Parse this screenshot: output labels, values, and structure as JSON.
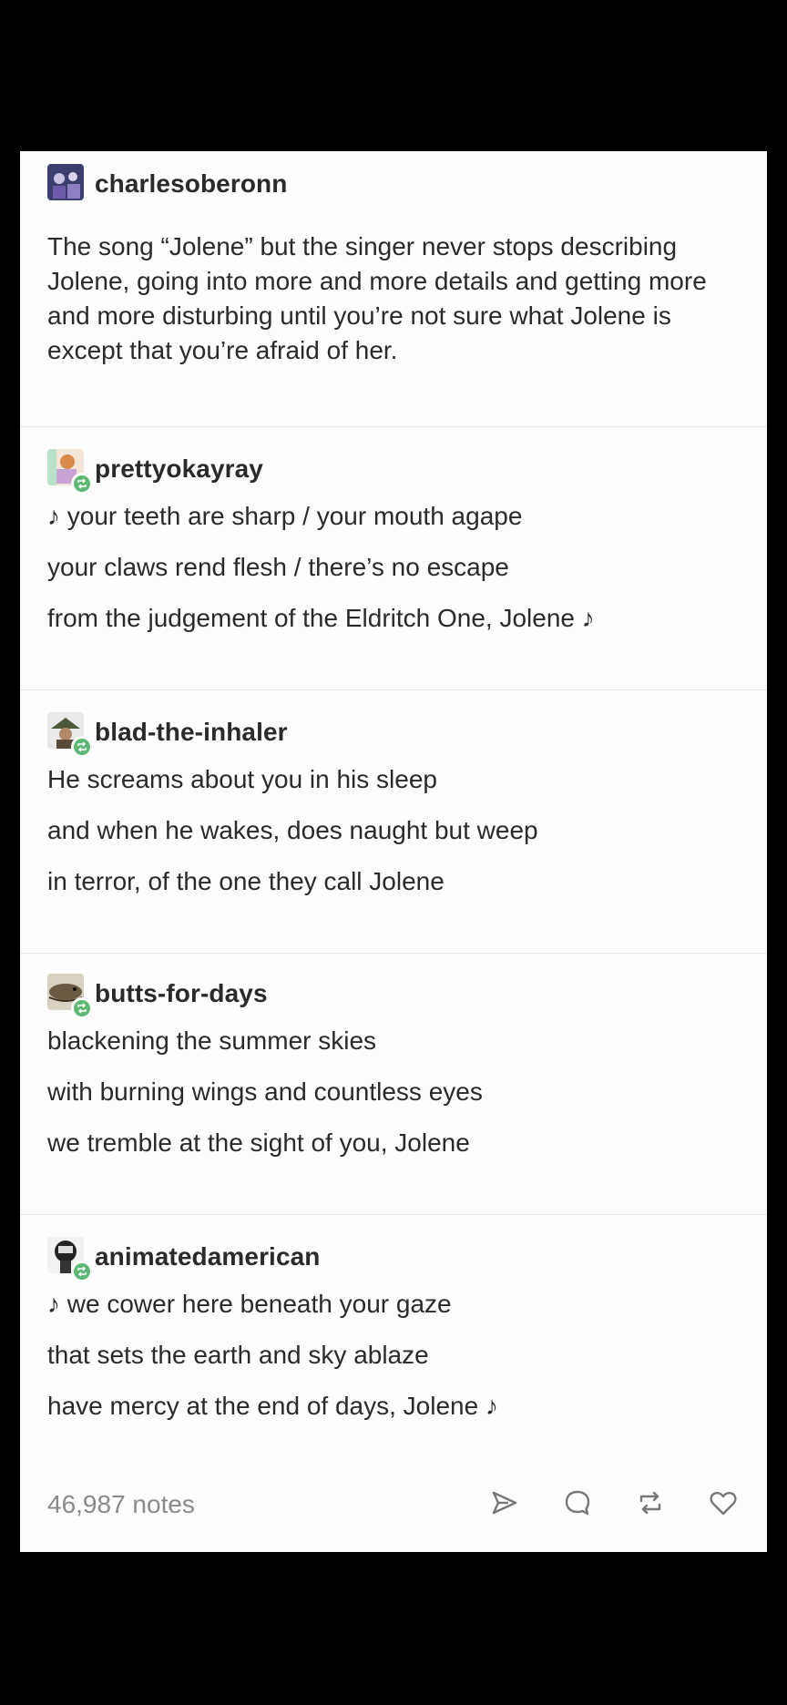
{
  "posts": [
    {
      "username": "charlesoberonn",
      "is_reblog": false,
      "text": "The song “Jolene” but the singer never stops describing Jolene, going into more and more details and getting more and more disturbing until you’re not sure what Jolene is except that you’re afraid of her."
    },
    {
      "username": "prettyokayray",
      "is_reblog": true,
      "lines": [
        "♪ your teeth are sharp / your mouth agape",
        "your claws rend flesh / there’s no escape",
        "from the judgement of the Eldritch One, Jolene ♪"
      ]
    },
    {
      "username": "blad-the-inhaler",
      "is_reblog": true,
      "lines": [
        "He screams about you in his sleep",
        "and when he wakes, does naught but weep",
        "in terror, of the one they call Jolene"
      ]
    },
    {
      "username": "butts-for-days",
      "is_reblog": true,
      "lines": [
        "blackening the summer skies",
        "with burning wings and countless eyes",
        "we tremble at the sight of you, Jolene"
      ]
    },
    {
      "username": "animatedamerican",
      "is_reblog": true,
      "lines": [
        "♪  we cower here beneath your gaze",
        "that sets the earth and sky ablaze",
        "have mercy at the end of days, Jolene  ♪"
      ]
    }
  ],
  "footer": {
    "notes": "46,987 notes",
    "actions": [
      "share-icon",
      "reply-icon",
      "reblog-icon",
      "like-icon"
    ]
  },
  "colors": {
    "background": "#000000",
    "card": "#fdfdfd",
    "text": "#2a2a2a",
    "muted": "#8a8a8a",
    "reblog_badge": "#5cb874"
  }
}
